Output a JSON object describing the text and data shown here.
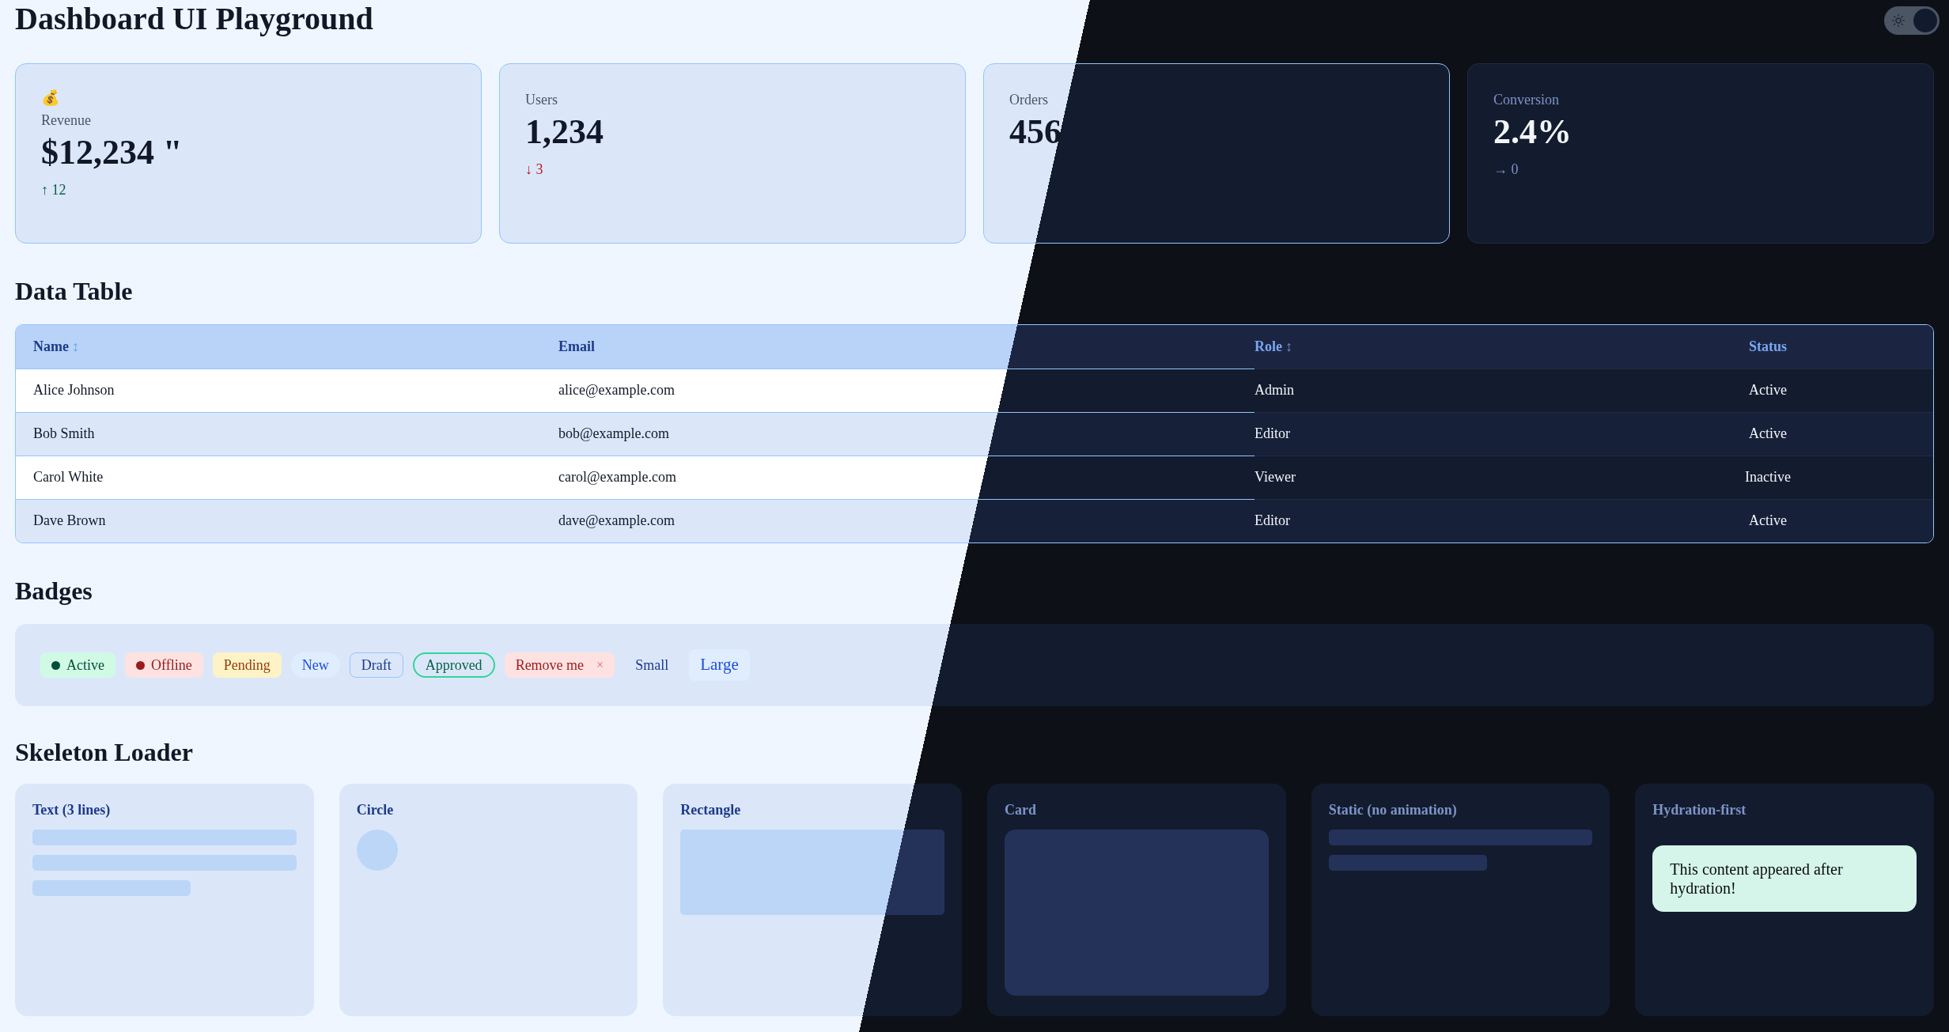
{
  "title": "Dashboard UI Playground",
  "theme_toggle": {
    "on": true
  },
  "stats": [
    {
      "icon": "💰",
      "label": "Revenue",
      "value": "$12,234 \"",
      "trend": {
        "text": "↑ 12",
        "kind": "up"
      }
    },
    {
      "label": "Users",
      "value": "1,234",
      "trend": {
        "text": "↓ 3",
        "kind": "down"
      }
    },
    {
      "label": "Orders",
      "value": "456"
    },
    {
      "label": "Conversion",
      "value": "2.4%",
      "trend": {
        "text": "→ 0",
        "kind": "flat"
      }
    }
  ],
  "table": {
    "heading": "Data Table",
    "columns": [
      {
        "label": "Name",
        "sort_indicator": "↕"
      },
      {
        "label": "Email"
      },
      {
        "label": "Role",
        "sort_indicator": "↕"
      },
      {
        "label": "Status"
      }
    ],
    "rows": [
      [
        "Alice Johnson",
        "alice@example.com",
        "Admin",
        "Active"
      ],
      [
        "Bob Smith",
        "bob@example.com",
        "Editor",
        "Active"
      ],
      [
        "Carol White",
        "carol@example.com",
        "Viewer",
        "Inactive"
      ],
      [
        "Dave Brown",
        "dave@example.com",
        "Editor",
        "Active"
      ]
    ]
  },
  "badges": {
    "heading": "Badges",
    "items": [
      {
        "label": "Active",
        "kind": "dot",
        "color": "#064e3b"
      },
      {
        "label": "Offline",
        "kind": "dot",
        "color": "#991b1b"
      },
      {
        "label": "Pending",
        "kind": "warning"
      },
      {
        "label": "New",
        "kind": "info"
      },
      {
        "label": "Draft",
        "kind": "outline"
      },
      {
        "label": "Approved",
        "kind": "outline-success"
      },
      {
        "label": "Remove me",
        "kind": "removable",
        "remove_icon": "×"
      },
      {
        "label": "Small",
        "kind": "small"
      },
      {
        "label": "Large",
        "kind": "large"
      }
    ]
  },
  "skeletons": {
    "heading": "Skeleton Loader",
    "items": [
      {
        "title": "Text (3 lines)",
        "kind": "text"
      },
      {
        "title": "Circle",
        "kind": "circle"
      },
      {
        "title": "Rectangle",
        "kind": "rectangle"
      },
      {
        "title": "Card",
        "kind": "card"
      },
      {
        "title": "Static (no animation)",
        "kind": "static"
      },
      {
        "title": "Hydration-first",
        "kind": "hydration",
        "message": "This content appeared after hydration!"
      }
    ]
  }
}
